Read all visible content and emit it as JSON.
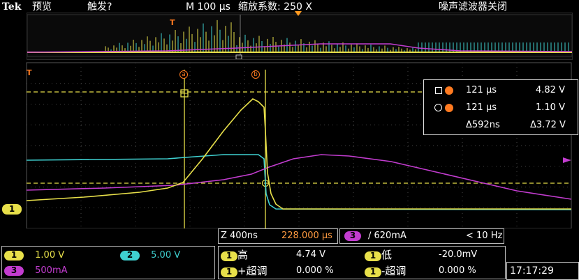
{
  "header": {
    "brand": "Tek",
    "mode": "预览",
    "trigger_state": "触发?",
    "timebase": "M 100 µs",
    "zoom_label": "缩放系数: 250 X",
    "filter_status": "噪声滤波器关闭"
  },
  "colors": {
    "ch1": "#e8e04a",
    "ch2": "#3fd0d0",
    "ch3": "#c23ccf",
    "cursor": "#e8e04a",
    "marker_orange": "#ff7a20"
  },
  "channel_markers": {
    "ch1_marker": "1",
    "a_marker": "a",
    "b_marker": "b"
  },
  "cursors": {
    "row1": {
      "time": "121 µs",
      "value": "4.82 V"
    },
    "row2": {
      "time": "121 µs",
      "value": "1.10 V"
    },
    "delta": {
      "time": "Δ592ns",
      "value": "Δ3.72 V"
    }
  },
  "timebar": {
    "zoom_scale": "Z 400ns",
    "zoom_position": "228.000 µs",
    "trigger_channel": "3",
    "trigger_level": "∕ 620mA",
    "trigger_freq": "< 10 Hz"
  },
  "channels": {
    "ch1": {
      "label": "1",
      "scale": "1.00 V"
    },
    "ch2": {
      "label": "2",
      "scale": "5.00 V"
    },
    "ch3": {
      "label": "3",
      "scale": "500mA"
    }
  },
  "measurements": {
    "high": {
      "channel": "1",
      "name": "高",
      "value": "4.74 V"
    },
    "low": {
      "channel": "1",
      "name": "低",
      "value": "-20.0mV"
    },
    "pos_overshoot": {
      "channel": "1",
      "name": "+超调",
      "value": "0.000 %"
    },
    "neg_overshoot": {
      "channel": "1",
      "name": "-超调",
      "value": "0.000 %"
    }
  },
  "clock": "17:17:29"
}
